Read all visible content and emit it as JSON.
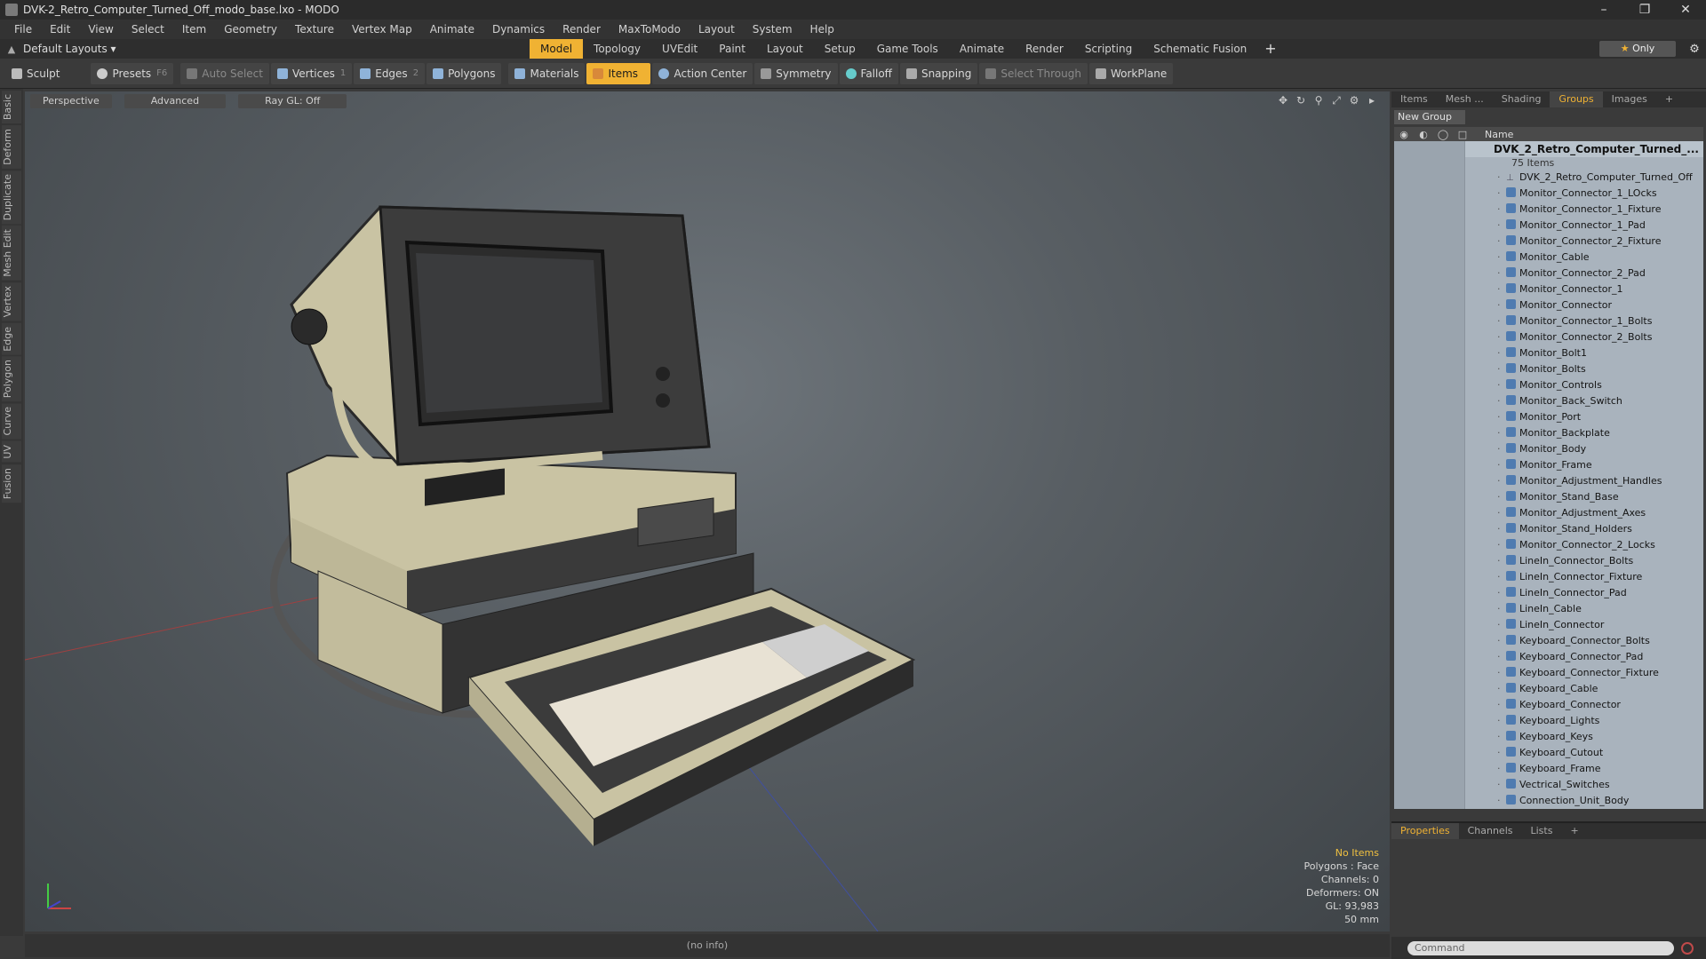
{
  "window": {
    "title": "DVK-2_Retro_Computer_Turned_Off_modo_base.lxo - MODO"
  },
  "menu": [
    "File",
    "Edit",
    "View",
    "Select",
    "Item",
    "Geometry",
    "Texture",
    "Vertex Map",
    "Animate",
    "Dynamics",
    "Render",
    "MaxToModo",
    "Layout",
    "System",
    "Help"
  ],
  "layout": {
    "current": "Default Layouts",
    "tabs": [
      "Model",
      "Topology",
      "UVEdit",
      "Paint",
      "Layout",
      "Setup",
      "Game Tools",
      "Animate",
      "Render",
      "Scripting",
      "Schematic Fusion"
    ],
    "active_tab": "Model",
    "only_label": "Only"
  },
  "toolbar": {
    "sculpt": "Sculpt",
    "presets": "Presets",
    "presets_key": "F6",
    "auto_select": "Auto Select",
    "vertices": "Vertices",
    "vertices_key": "1",
    "edges": "Edges",
    "edges_key": "2",
    "polygons": "Polygons",
    "materials": "Materials",
    "items": "Items",
    "action_center": "Action Center",
    "symmetry": "Symmetry",
    "falloff": "Falloff",
    "snapping": "Snapping",
    "select_through": "Select Through",
    "workplane": "WorkPlane"
  },
  "left_tabs": [
    "Basic",
    "Deform",
    "Duplicate",
    "Mesh Edit",
    "Vertex",
    "Edge",
    "Polygon",
    "Curve",
    "UV",
    "Fusion"
  ],
  "viewport": {
    "view": "Perspective",
    "shading": "Advanced",
    "raygl": "Ray GL: Off",
    "info": {
      "items": "No Items",
      "polygons": "Polygons : Face",
      "channels": "Channels: 0",
      "deformers": "Deformers: ON",
      "gl": "GL: 93,983",
      "size": "50 mm"
    }
  },
  "status": "(no info)",
  "panel": {
    "tabs": [
      "Items",
      "Mesh ...",
      "Shading",
      "Groups",
      "Images"
    ],
    "active_tab": "Groups",
    "new_group": "New Group",
    "col_name": "Name",
    "root": "DVK_2_Retro_Computer_Turned_...",
    "root_count": "75 Items",
    "items": [
      "DVK_2_Retro_Computer_Turned_Off",
      "Monitor_Connector_1_LOcks",
      "Monitor_Connector_1_Fixture",
      "Monitor_Connector_1_Pad",
      "Monitor_Connector_2_Fixture",
      "Monitor_Cable",
      "Monitor_Connector_2_Pad",
      "Monitor_Connector_1",
      "Monitor_Connector",
      "Monitor_Connector_1_Bolts",
      "Monitor_Connector_2_Bolts",
      "Monitor_Bolt1",
      "Monitor_Bolts",
      "Monitor_Controls",
      "Monitor_Back_Switch",
      "Monitor_Port",
      "Monitor_Backplate",
      "Monitor_Body",
      "Monitor_Frame",
      "Monitor_Adjustment_Handles",
      "Monitor_Stand_Base",
      "Monitor_Adjustment_Axes",
      "Monitor_Stand_Holders",
      "Monitor_Connector_2_Locks",
      "LineIn_Connector_Bolts",
      "LineIn_Connector_Fixture",
      "LineIn_Connector_Pad",
      "LineIn_Cable",
      "LineIn_Connector",
      "Keyboard_Connector_Bolts",
      "Keyboard_Connector_Pad",
      "Keyboard_Connector_Fixture",
      "Keyboard_Cable",
      "Keyboard_Connector",
      "Keyboard_Lights",
      "Keyboard_Keys",
      "Keyboard_Cutout",
      "Keyboard_Frame",
      "Vectrical_Switches",
      "Connection_Unit_Body"
    ]
  },
  "props": {
    "tabs": [
      "Properties",
      "Channels",
      "Lists"
    ],
    "active_tab": "Properties"
  },
  "command": {
    "placeholder": "Command"
  },
  "colors": {
    "accent": "#f0b233",
    "tree_bg": "#a9b3bd"
  }
}
